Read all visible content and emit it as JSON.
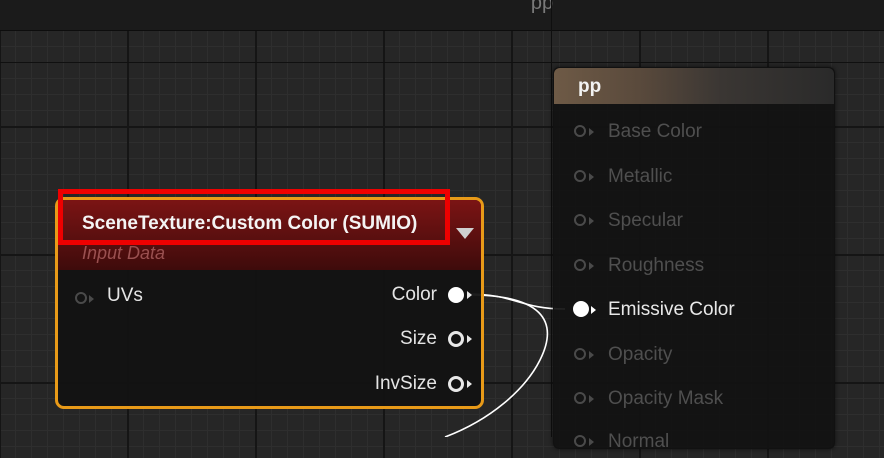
{
  "graph": {
    "title": "pp"
  },
  "result_node": {
    "title": "pp",
    "inputs": [
      {
        "label": "Base Color",
        "connected": false
      },
      {
        "label": "Metallic",
        "connected": false
      },
      {
        "label": "Specular",
        "connected": false
      },
      {
        "label": "Roughness",
        "connected": false
      },
      {
        "label": "Emissive Color",
        "connected": true
      },
      {
        "label": "Opacity",
        "connected": false
      },
      {
        "label": "Opacity Mask",
        "connected": false
      },
      {
        "label": "Normal",
        "connected": false
      }
    ]
  },
  "scene_texture_node": {
    "title": "SceneTexture:Custom Color (SUMIO)",
    "subtitle": "Input Data",
    "input": {
      "label": "UVs"
    },
    "outputs": [
      {
        "label": "Color",
        "connected": true
      },
      {
        "label": "Size",
        "connected": false
      },
      {
        "label": "InvSize",
        "connected": false
      }
    ]
  },
  "colors": {
    "node_border_selected": "#e89a18",
    "header_red": "#7b1414",
    "highlight_red": "#ee0000",
    "wire": "#ffffff"
  }
}
